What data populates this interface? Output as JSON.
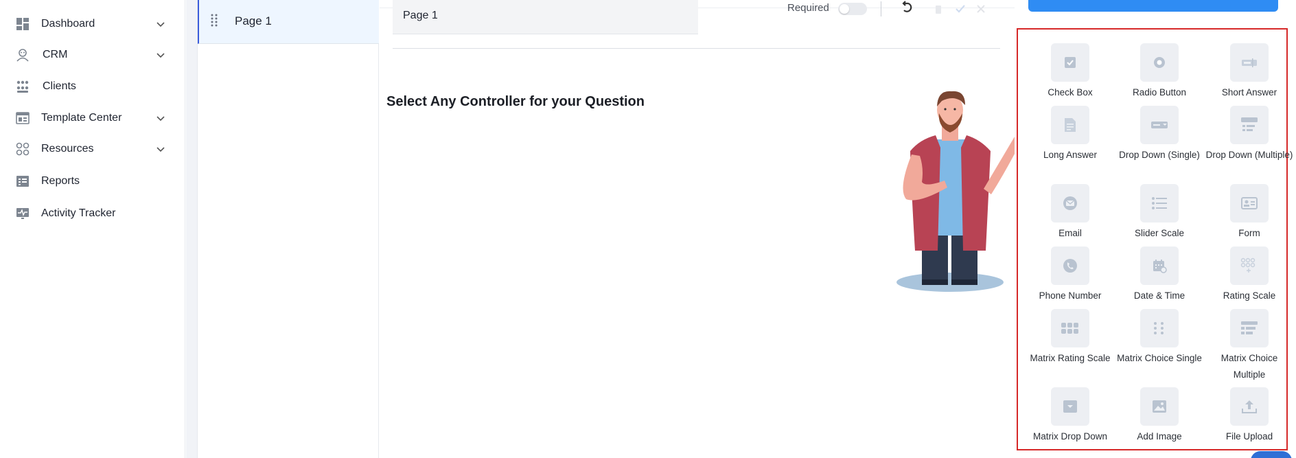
{
  "sidebar": {
    "items": [
      {
        "label": "Dashboard",
        "icon": "dashboard-icon",
        "expandable": true
      },
      {
        "label": "CRM",
        "icon": "crm-icon",
        "expandable": true
      },
      {
        "label": "Clients",
        "icon": "clients-icon",
        "expandable": false
      },
      {
        "label": "Template Center",
        "icon": "template-icon",
        "expandable": true
      },
      {
        "label": "Resources",
        "icon": "resources-icon",
        "expandable": true
      },
      {
        "label": "Reports",
        "icon": "reports-icon",
        "expandable": false
      },
      {
        "label": "Activity Tracker",
        "icon": "activity-icon",
        "expandable": false
      }
    ]
  },
  "pages": {
    "items": [
      {
        "label": "Page 1"
      }
    ]
  },
  "editor": {
    "page_title": "Page 1",
    "required_label": "Required",
    "required_on": false,
    "prompt": "Select Any Controller for your Question"
  },
  "palette": {
    "controllers": [
      {
        "label": "Check Box",
        "icon": "checkbox-icon"
      },
      {
        "label": "Radio Button",
        "icon": "radio-icon"
      },
      {
        "label": "Short Answer",
        "icon": "short-answer-icon"
      },
      {
        "label": "Long Answer",
        "icon": "long-answer-icon"
      },
      {
        "label": "Drop Down (Single)",
        "icon": "dropdown-single-icon"
      },
      {
        "label": "Drop Down (Multiple)",
        "icon": "dropdown-multiple-icon"
      },
      {
        "label": "Email",
        "icon": "email-icon"
      },
      {
        "label": "Slider Scale",
        "icon": "slider-icon"
      },
      {
        "label": "Form",
        "icon": "form-icon"
      },
      {
        "label": "Phone Number",
        "icon": "phone-icon"
      },
      {
        "label": "Date & Time",
        "icon": "calendar-icon"
      },
      {
        "label": "Rating Scale",
        "icon": "rating-icon"
      },
      {
        "label": "Matrix Rating Scale",
        "icon": "matrix-rating-icon"
      },
      {
        "label": "Matrix Choice Single",
        "icon": "matrix-single-icon"
      },
      {
        "label": "Matrix Choice Multiple",
        "icon": "matrix-multiple-icon"
      },
      {
        "label": "Matrix Drop Down",
        "icon": "matrix-dropdown-icon"
      },
      {
        "label": "Add Image",
        "icon": "image-icon"
      },
      {
        "label": "File Upload",
        "icon": "upload-icon"
      }
    ]
  },
  "colors": {
    "accent": "#2f8cf3",
    "highlight_border": "#d62828",
    "active_page_bg": "#eef6ff",
    "icon_gray": "#b9c3d0"
  }
}
